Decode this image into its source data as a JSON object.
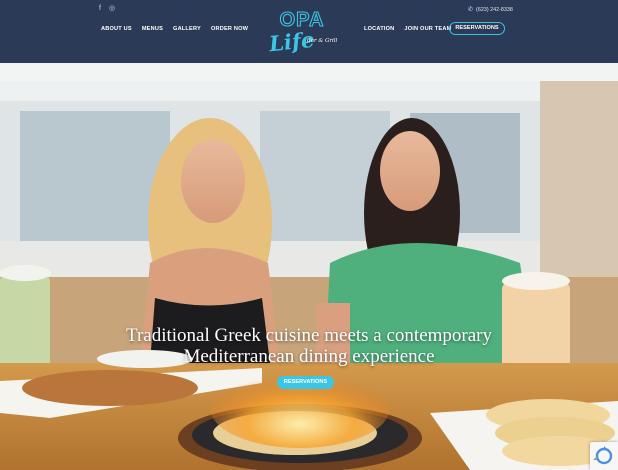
{
  "header": {
    "social": [
      {
        "icon": "facebook-icon",
        "glyph": "f"
      },
      {
        "icon": "instagram-icon",
        "glyph": "◎"
      }
    ],
    "nav_left": [
      "ABOUT US",
      "MENUS",
      "GALLERY",
      "ORDER NOW"
    ],
    "nav_right": [
      "LOCATION",
      "JOIN OUR TEAM"
    ],
    "phone": "(623) 242-8338",
    "reservations_label": "RESERVATIONS",
    "logo": {
      "line1": "OPA",
      "line2": "Life",
      "line3": "Bar & Grill"
    }
  },
  "hero": {
    "headline_line1": "Traditional Greek cuisine meets a contemporary",
    "headline_line2": "Mediterranean dining experience",
    "reservations_label": "RESERVATIONS"
  },
  "colors": {
    "header_bg": "#2b3a57",
    "accent": "#3cc6e6"
  }
}
